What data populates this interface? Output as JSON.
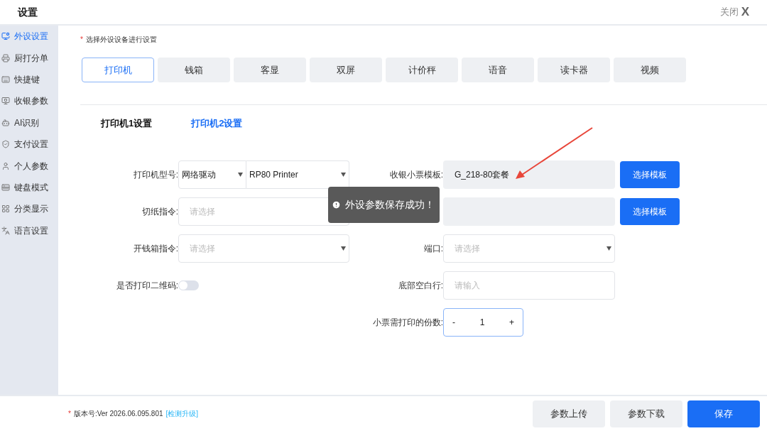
{
  "window": {
    "title": "设置",
    "close_label": "关闭",
    "close_glyph": "X"
  },
  "sidebar": {
    "items": [
      {
        "label": "外设设置",
        "selected": true
      },
      {
        "label": "厨打分单",
        "selected": false
      },
      {
        "label": "快捷键",
        "selected": false
      },
      {
        "label": "收银参数",
        "selected": false
      },
      {
        "label": "AI识别",
        "selected": false
      },
      {
        "label": "支付设置",
        "selected": false
      },
      {
        "label": "个人参数",
        "selected": false
      },
      {
        "label": "键盘模式",
        "selected": false
      },
      {
        "label": "分类显示",
        "selected": false
      },
      {
        "label": "语言设置",
        "selected": false
      }
    ]
  },
  "hint": {
    "mark": "*",
    "text": "选择外设设备进行设置"
  },
  "device_tabs": [
    {
      "label": "打印机",
      "selected": true
    },
    {
      "label": "钱箱",
      "selected": false
    },
    {
      "label": "客显",
      "selected": false
    },
    {
      "label": "双屏",
      "selected": false
    },
    {
      "label": "计价秤",
      "selected": false
    },
    {
      "label": "语音",
      "selected": false
    },
    {
      "label": "读卡器",
      "selected": false
    },
    {
      "label": "视频",
      "selected": false
    }
  ],
  "printer_tabs": [
    {
      "label": "打印机1设置",
      "selected": false
    },
    {
      "label": "打印机2设置",
      "selected": true
    }
  ],
  "form": {
    "left": [
      {
        "kind": "double_select",
        "label": "打印机型号:",
        "values": [
          "网络驱动",
          "RP80 Printer"
        ]
      },
      {
        "kind": "input",
        "label": "切纸指令:",
        "placeholder": "请选择"
      },
      {
        "kind": "select",
        "label": "开钱箱指令:",
        "placeholder": "请选择"
      },
      {
        "kind": "toggle",
        "label": "是否打印二维码:",
        "on": false
      }
    ],
    "right": [
      {
        "kind": "template",
        "label": "收银小票模板:",
        "value": "G_218-80套餐",
        "button": "选择模板"
      },
      {
        "kind": "template",
        "button": "选择模板"
      },
      {
        "kind": "select",
        "label": "端口:",
        "placeholder": "请选择"
      },
      {
        "kind": "input",
        "label": "底部空白行:",
        "placeholder": "请输入"
      },
      {
        "kind": "stepper",
        "label": "小票需打印的份数:",
        "minus": "-",
        "value": "1",
        "plus": "+"
      }
    ]
  },
  "toast": {
    "text": "外设参数保存成功！"
  },
  "annotation": {
    "kind": "arrow"
  },
  "footer": {
    "mark": "*",
    "version": "版本号:Ver 2026.06.095.801",
    "link": "[检测升级]",
    "buttons": [
      {
        "label": "参数上传",
        "kind": "secondary"
      },
      {
        "label": "参数下载",
        "kind": "secondary"
      },
      {
        "label": "保存",
        "kind": "primary"
      }
    ]
  }
}
